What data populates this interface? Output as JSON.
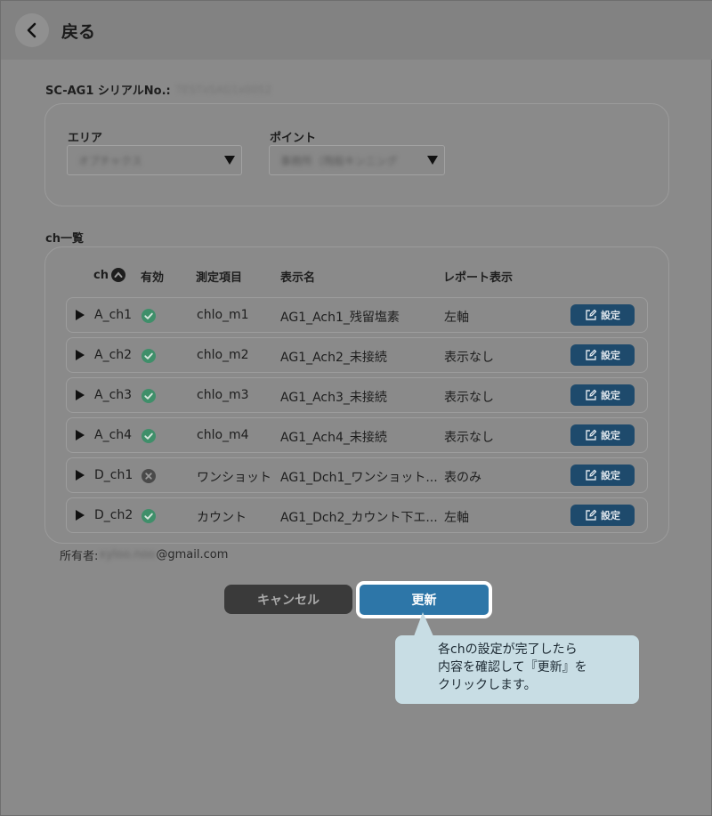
{
  "header": {
    "back_label": "戻る"
  },
  "serial": {
    "label": "SC-AG1 シリアルNo.:",
    "value": "TESTxSAG1x0052"
  },
  "area": {
    "label": "エリア",
    "value": "オプチャクス"
  },
  "point": {
    "label": "ポイント",
    "value": "事務所（飛船キンニング"
  },
  "chlist": {
    "label": "ch一覧",
    "headers": {
      "ch": "ch",
      "enabled": "有効",
      "item": "測定項目",
      "display_name": "表示名",
      "report": "レポート表示"
    },
    "set_label": "設定",
    "rows": [
      {
        "ch": "A_ch1",
        "status": "enabled",
        "item": "chlo_m1",
        "display_name": "AG1_Ach1_残留塩素",
        "report": "左軸"
      },
      {
        "ch": "A_ch2",
        "status": "enabled",
        "item": "chlo_m2",
        "display_name": "AG1_Ach2_未接続",
        "report": "表示なし"
      },
      {
        "ch": "A_ch3",
        "status": "enabled",
        "item": "chlo_m3",
        "display_name": "AG1_Ach3_未接続",
        "report": "表示なし"
      },
      {
        "ch": "A_ch4",
        "status": "enabled",
        "item": "chlo_m4",
        "display_name": "AG1_Ach4_未接続",
        "report": "表示なし"
      },
      {
        "ch": "D_ch1",
        "status": "disabled",
        "item": "ワンショット",
        "display_name": "AG1_Dch1_ワンショット...",
        "report": "表のみ"
      },
      {
        "ch": "D_ch2",
        "status": "enabled",
        "item": "カウント",
        "display_name": "AG1_Dch2_カウント下エ...",
        "report": "左軸"
      }
    ]
  },
  "owner": {
    "label": "所有者:",
    "user": "xyloo.noo",
    "domain": "@gmail.com"
  },
  "buttons": {
    "cancel": "キャンセル",
    "update": "更新"
  },
  "tooltip": {
    "line1": "各chの設定が完了したら",
    "line2": "内容を確認して『更新』を",
    "line3": "クリックします。"
  },
  "colors": {
    "enabled": "#3f8f6a",
    "disabled": "#4a4a4a",
    "set_button": "#1e4a6c",
    "update_button": "#2d76a8",
    "tooltip_bg": "#c8dde4"
  }
}
